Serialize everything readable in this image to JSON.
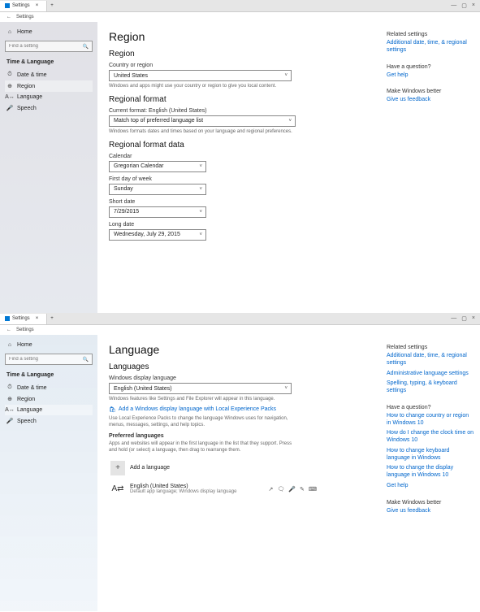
{
  "shot1": {
    "titlebar": {
      "tab": "Settings",
      "close": "×",
      "plus": "+",
      "sys_min": "—",
      "sys_max": "▢",
      "sys_close": "×"
    },
    "subbar": {
      "back": "←",
      "title": "Settings"
    },
    "sidebar": {
      "home": "Home",
      "search_placeholder": "Find a setting",
      "category": "Time & Language",
      "items": [
        {
          "icon": "⏱",
          "label": "Date & time"
        },
        {
          "icon": "⊕",
          "label": "Region"
        },
        {
          "icon": "A↔",
          "label": "Language"
        },
        {
          "icon": "🎤",
          "label": "Speech"
        }
      ]
    },
    "page": {
      "title": "Region",
      "section1": "Region",
      "country_label": "Country or region",
      "country_value": "United States",
      "country_desc": "Windows and apps might use your country or region to give you local content.",
      "section2": "Regional format",
      "curfmt_label": "Current format: English (United States)",
      "curfmt_value": "Match top of preferred language list",
      "curfmt_desc": "Windows formats dates and times based on your language and regional preferences.",
      "section3": "Regional format data",
      "calendar_label": "Calendar",
      "calendar_value": "Gregorian Calendar",
      "firstday_label": "First day of week",
      "firstday_value": "Sunday",
      "shortdate_label": "Short date",
      "shortdate_value": "7/29/2015",
      "longdate_label": "Long date",
      "longdate_value": "Wednesday, July 29, 2015"
    },
    "right": {
      "related_head": "Related settings",
      "related_link": "Additional date, time, & regional settings",
      "question_head": "Have a question?",
      "question_link": "Get help",
      "better_head": "Make Windows better",
      "better_link": "Give us feedback"
    }
  },
  "shot2": {
    "titlebar": {
      "tab": "Settings",
      "close": "×",
      "plus": "+",
      "sys_min": "—",
      "sys_max": "▢",
      "sys_close": "×"
    },
    "subbar": {
      "back": "←",
      "title": "Settings"
    },
    "sidebar": {
      "home": "Home",
      "search_placeholder": "Find a setting",
      "category": "Time & Language",
      "items": [
        {
          "icon": "⏱",
          "label": "Date & time"
        },
        {
          "icon": "⊕",
          "label": "Region"
        },
        {
          "icon": "A↔",
          "label": "Language"
        },
        {
          "icon": "🎤",
          "label": "Speech"
        }
      ]
    },
    "page": {
      "title": "Language",
      "section1": "Languages",
      "disp_label": "Windows display language",
      "disp_value": "English (United States)",
      "disp_desc": "Windows features like Settings and File Explorer will appear in this language.",
      "disp_link": "Add a Windows display language with Local Experience Packs",
      "lep_desc": "Use Local Experience Packs to change the language Windows uses for navigation, menus, messages, settings, and help topics.",
      "pref_head": "Preferred languages",
      "pref_desc": "Apps and websites will appear in the first language in the list that they support. Press and hold (or select) a language, then drag to rearrange them.",
      "add_label": "Add a language",
      "lang_name": "English (United States)",
      "lang_sub": "Default app language; Windows display language",
      "lang_icons": {
        "a": "↗",
        "b": "🗨",
        "c": "🎤",
        "d": "✎",
        "e": "⌨"
      }
    },
    "right": {
      "related_head": "Related settings",
      "related_link1": "Additional date, time, & regional settings",
      "related_link2": "Administrative language settings",
      "related_link3": "Spelling, typing, & keyboard settings",
      "question_head": "Have a question?",
      "q1": "How to change country or region in Windows 10",
      "q2": "How do I change the clock time on Windows 10",
      "q3": "How to change keyboard language in Windows",
      "q4": "How to change the display language in Windows 10",
      "q5": "Get help",
      "better_head": "Make Windows better",
      "better_link": "Give us feedback"
    }
  }
}
